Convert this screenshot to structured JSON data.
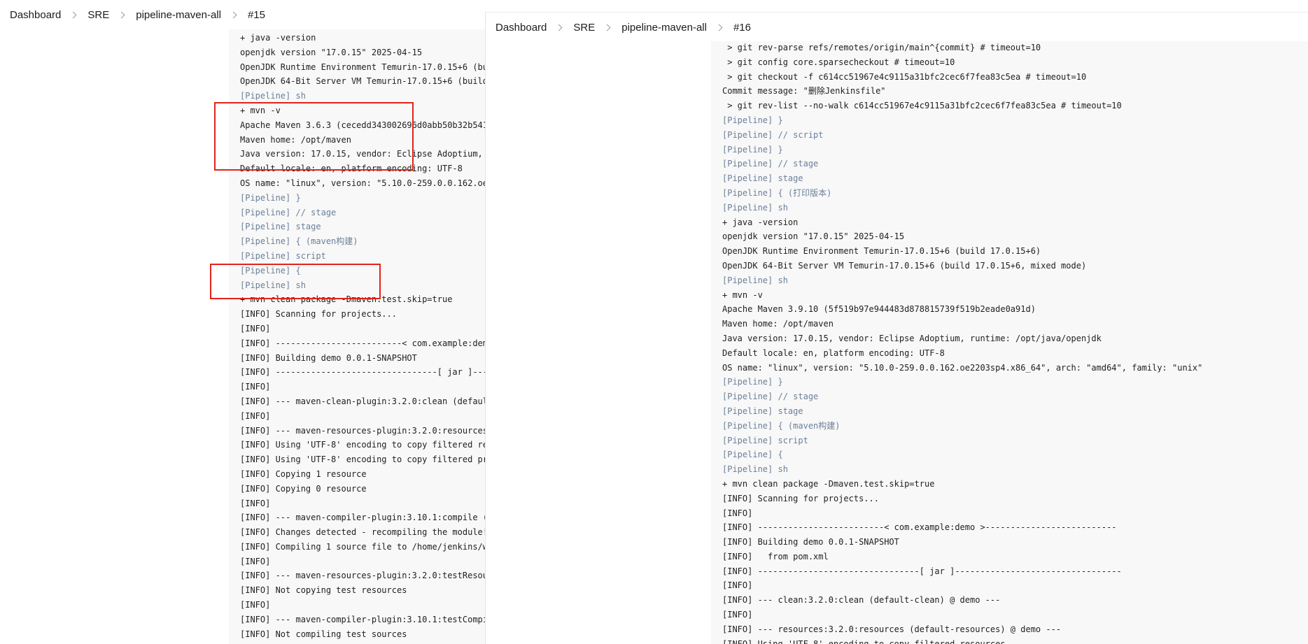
{
  "left_panel": {
    "breadcrumb": [
      "Dashboard",
      "SRE",
      "pipeline-maven-all",
      "#15"
    ],
    "console_lines": [
      {
        "text": "+ java -version",
        "type": "cmd"
      },
      {
        "text": "openjdk version \"17.0.15\" 2025-04-15",
        "type": "out"
      },
      {
        "text": "OpenJDK Runtime Environment Temurin-17.0.15+6 (bui",
        "type": "out"
      },
      {
        "text": "OpenJDK 64-Bit Server VM Temurin-17.0.15+6 (build 1",
        "type": "out"
      },
      {
        "text": "[Pipeline] sh",
        "type": "pipeline"
      },
      {
        "text": "+ mvn -v",
        "type": "cmd"
      },
      {
        "text": "Apache Maven 3.6.3 (cecedd343002696d0abb50b32b541b8",
        "type": "out"
      },
      {
        "text": "Maven home: /opt/maven",
        "type": "out"
      },
      {
        "text": "Java version: 17.0.15, vendor: Eclipse Adoptium, ru",
        "type": "out"
      },
      {
        "text": "Default locale: en, platform encoding: UTF-8",
        "type": "out"
      },
      {
        "text": "OS name: \"linux\", version: \"5.10.0-259.0.0.162.oe22",
        "type": "out"
      },
      {
        "text": "[Pipeline] }",
        "type": "pipeline"
      },
      {
        "text": "[Pipeline] // stage",
        "type": "pipeline"
      },
      {
        "text": "[Pipeline] stage",
        "type": "pipeline"
      },
      {
        "text": "[Pipeline] { (maven构建)",
        "type": "pipeline"
      },
      {
        "text": "[Pipeline] script",
        "type": "pipeline"
      },
      {
        "text": "[Pipeline] {",
        "type": "pipeline"
      },
      {
        "text": "[Pipeline] sh",
        "type": "pipeline"
      },
      {
        "text": "+ mvn clean package -Dmaven.test.skip=true",
        "type": "cmd"
      },
      {
        "text": "[INFO] Scanning for projects...",
        "type": "out"
      },
      {
        "text": "[INFO]",
        "type": "out"
      },
      {
        "text": "[INFO] -------------------------< com.example:demo",
        "type": "out"
      },
      {
        "text": "[INFO] Building demo 0.0.1-SNAPSHOT",
        "type": "out"
      },
      {
        "text": "[INFO] --------------------------------[ jar ]-----",
        "type": "out"
      },
      {
        "text": "[INFO]",
        "type": "out"
      },
      {
        "text": "[INFO] --- maven-clean-plugin:3.2.0:clean (default-",
        "type": "out"
      },
      {
        "text": "[INFO]",
        "type": "out"
      },
      {
        "text": "[INFO] --- maven-resources-plugin:3.2.0:resources (",
        "type": "out"
      },
      {
        "text": "[INFO] Using 'UTF-8' encoding to copy filtered reso",
        "type": "out"
      },
      {
        "text": "[INFO] Using 'UTF-8' encoding to copy filtered prop",
        "type": "out"
      },
      {
        "text": "[INFO] Copying 1 resource",
        "type": "out"
      },
      {
        "text": "[INFO] Copying 0 resource",
        "type": "out"
      },
      {
        "text": "[INFO]",
        "type": "out"
      },
      {
        "text": "[INFO] --- maven-compiler-plugin:3.10.1:compile (de",
        "type": "out"
      },
      {
        "text": "[INFO] Changes detected - recompiling the module!",
        "type": "out"
      },
      {
        "text": "[INFO] Compiling 1 source file to /home/jenkins/wor",
        "type": "out"
      },
      {
        "text": "[INFO]",
        "type": "out"
      },
      {
        "text": "[INFO] --- maven-resources-plugin:3.2.0:testResourc",
        "type": "out"
      },
      {
        "text": "[INFO] Not copying test resources",
        "type": "out"
      },
      {
        "text": "[INFO]",
        "type": "out"
      },
      {
        "text": "[INFO] --- maven-compiler-plugin:3.10.1:testCompile",
        "type": "out"
      },
      {
        "text": "[INFO] Not compiling test sources",
        "type": "out"
      }
    ]
  },
  "right_panel": {
    "breadcrumb": [
      "Dashboard",
      "SRE",
      "pipeline-maven-all",
      "#16"
    ],
    "console_lines": [
      {
        "text": " > git rev-parse refs/remotes/origin/main^{commit} # timeout=10",
        "type": "out"
      },
      {
        "text": " > git config core.sparsecheckout # timeout=10",
        "type": "out"
      },
      {
        "text": " > git checkout -f c614cc51967e4c9115a31bfc2cec6f7fea83c5ea # timeout=10",
        "type": "out"
      },
      {
        "text": "Commit message: \"删除Jenkinsfile\"",
        "type": "out"
      },
      {
        "text": " > git rev-list --no-walk c614cc51967e4c9115a31bfc2cec6f7fea83c5ea # timeout=10",
        "type": "out"
      },
      {
        "text": "[Pipeline] }",
        "type": "pipeline"
      },
      {
        "text": "[Pipeline] // script",
        "type": "pipeline"
      },
      {
        "text": "[Pipeline] }",
        "type": "pipeline"
      },
      {
        "text": "[Pipeline] // stage",
        "type": "pipeline"
      },
      {
        "text": "[Pipeline] stage",
        "type": "pipeline"
      },
      {
        "text": "[Pipeline] { (打印版本)",
        "type": "pipeline"
      },
      {
        "text": "[Pipeline] sh",
        "type": "pipeline"
      },
      {
        "text": "+ java -version",
        "type": "cmd"
      },
      {
        "text": "openjdk version \"17.0.15\" 2025-04-15",
        "type": "out"
      },
      {
        "text": "OpenJDK Runtime Environment Temurin-17.0.15+6 (build 17.0.15+6)",
        "type": "out"
      },
      {
        "text": "OpenJDK 64-Bit Server VM Temurin-17.0.15+6 (build 17.0.15+6, mixed mode)",
        "type": "out"
      },
      {
        "text": "[Pipeline] sh",
        "type": "pipeline"
      },
      {
        "text": "+ mvn -v",
        "type": "cmd"
      },
      {
        "text": "Apache Maven 3.9.10 (5f519b97e944483d878815739f519b2eade0a91d)",
        "type": "out"
      },
      {
        "text": "Maven home: /opt/maven",
        "type": "out"
      },
      {
        "text": "Java version: 17.0.15, vendor: Eclipse Adoptium, runtime: /opt/java/openjdk",
        "type": "out"
      },
      {
        "text": "Default locale: en, platform encoding: UTF-8",
        "type": "out"
      },
      {
        "text": "OS name: \"linux\", version: \"5.10.0-259.0.0.162.oe2203sp4.x86_64\", arch: \"amd64\", family: \"unix\"",
        "type": "out"
      },
      {
        "text": "[Pipeline] }",
        "type": "pipeline"
      },
      {
        "text": "[Pipeline] // stage",
        "type": "pipeline"
      },
      {
        "text": "[Pipeline] stage",
        "type": "pipeline"
      },
      {
        "text": "[Pipeline] { (maven构建)",
        "type": "pipeline"
      },
      {
        "text": "[Pipeline] script",
        "type": "pipeline"
      },
      {
        "text": "[Pipeline] {",
        "type": "pipeline"
      },
      {
        "text": "[Pipeline] sh",
        "type": "pipeline"
      },
      {
        "text": "+ mvn clean package -Dmaven.test.skip=true",
        "type": "cmd"
      },
      {
        "text": "[INFO] Scanning for projects...",
        "type": "out"
      },
      {
        "text": "[INFO]",
        "type": "out"
      },
      {
        "text": "[INFO] -------------------------< com.example:demo >--------------------------",
        "type": "out"
      },
      {
        "text": "[INFO] Building demo 0.0.1-SNAPSHOT",
        "type": "out"
      },
      {
        "text": "[INFO]   from pom.xml",
        "type": "out"
      },
      {
        "text": "[INFO] --------------------------------[ jar ]---------------------------------",
        "type": "out"
      },
      {
        "text": "[INFO]",
        "type": "out"
      },
      {
        "text": "[INFO] --- clean:3.2.0:clean (default-clean) @ demo ---",
        "type": "out"
      },
      {
        "text": "[INFO]",
        "type": "out"
      },
      {
        "text": "[INFO] --- resources:3.2.0:resources (default-resources) @ demo ---",
        "type": "out"
      },
      {
        "text": "[INFO] Using 'UTF-8' encoding to copy filtered resources.",
        "type": "out"
      }
    ]
  },
  "colors": {
    "pipeline_text": "#6b7f99",
    "console_text": "#1f1f1f",
    "console_bg": "#f8f8f8",
    "highlight": "#e2231a"
  }
}
